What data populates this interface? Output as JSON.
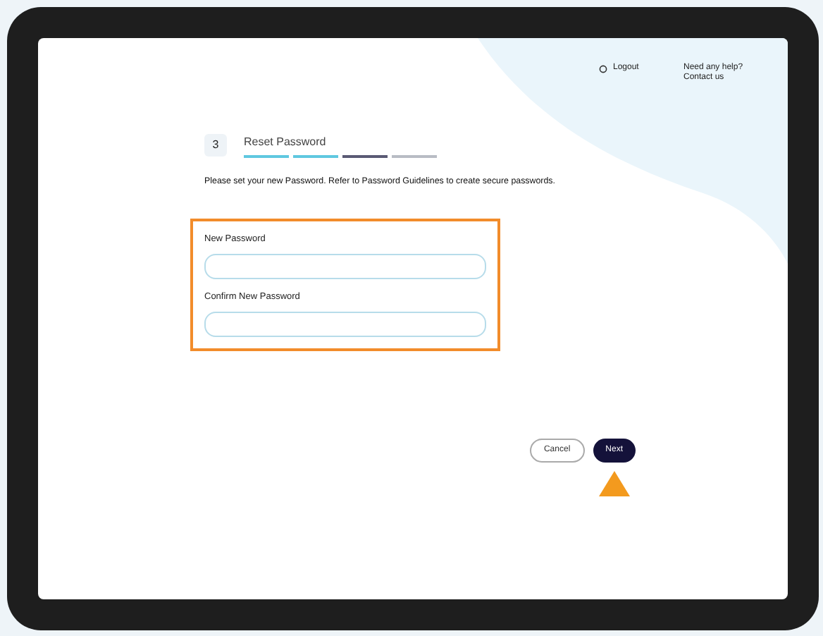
{
  "header": {
    "links": [
      {
        "kind": "icon",
        "label": "Logout"
      },
      {
        "kind": "plain",
        "label": "Need any help? Contact us"
      }
    ]
  },
  "step": {
    "number": "3",
    "title": "Reset Password",
    "segments": [
      {
        "color": "#5fc8e0"
      },
      {
        "color": "#5fc8e0"
      },
      {
        "color": "#5a5a74"
      },
      {
        "color": "#b8bcc4"
      }
    ]
  },
  "instructions": "Please set your new Password. Refer to Password Guidelines to create secure passwords.",
  "fields": [
    {
      "label": "New Password"
    },
    {
      "label": "Confirm New Password"
    }
  ],
  "buttons": [
    {
      "kind": "secondary",
      "label": "Cancel"
    },
    {
      "kind": "primary",
      "label": "Next"
    }
  ]
}
